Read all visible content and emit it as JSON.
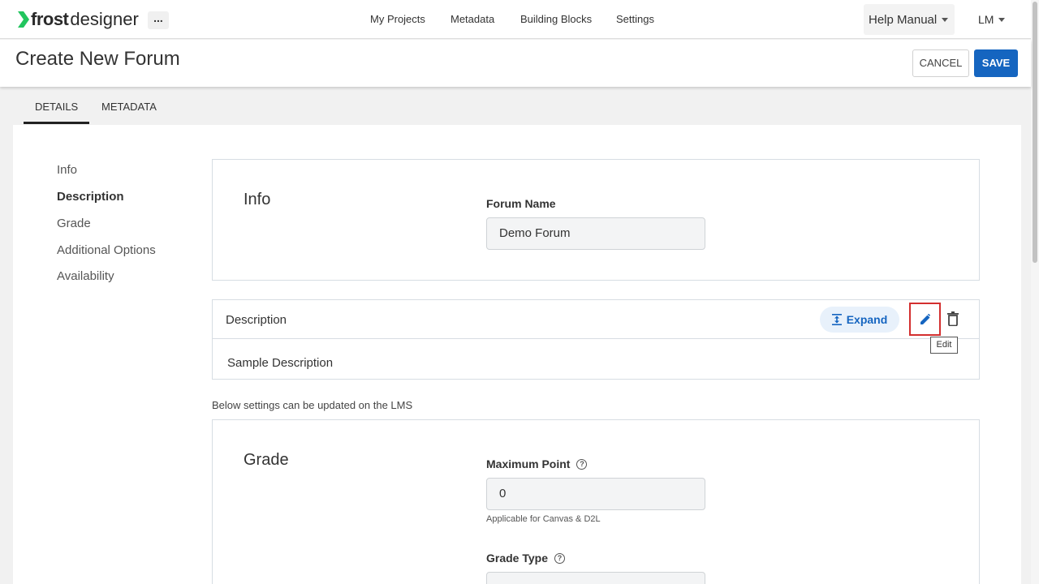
{
  "topbar": {
    "logo_frost": "frost",
    "logo_designer": "designer",
    "more_label": "...",
    "nav": [
      "My Projects",
      "Metadata",
      "Building Blocks",
      "Settings"
    ],
    "help_label": "Help Manual",
    "user_label": "LM"
  },
  "header": {
    "title": "Create New Forum",
    "cancel_label": "CANCEL",
    "save_label": "SAVE"
  },
  "tabs": [
    "DETAILS",
    "METADATA"
  ],
  "sidebar": {
    "items": [
      {
        "label": "Info"
      },
      {
        "label": "Description"
      },
      {
        "label": "Grade"
      },
      {
        "label": "Additional Options"
      },
      {
        "label": "Availability"
      }
    ]
  },
  "info": {
    "title": "Info",
    "forum_name_label": "Forum Name",
    "forum_name_value": "Demo Forum"
  },
  "description": {
    "title": "Description",
    "expand_label": "Expand",
    "text": "Sample Description",
    "tooltip": "Edit"
  },
  "lms_note": "Below settings can be updated on the LMS",
  "grade": {
    "title": "Grade",
    "max_point_label": "Maximum Point",
    "max_point_value": "0",
    "max_point_note": "Applicable for Canvas & D2L",
    "grade_type_label": "Grade Type"
  },
  "colors": {
    "accent": "#1565c0",
    "highlight": "#d32f2f",
    "logo_green": "#22c55e"
  }
}
